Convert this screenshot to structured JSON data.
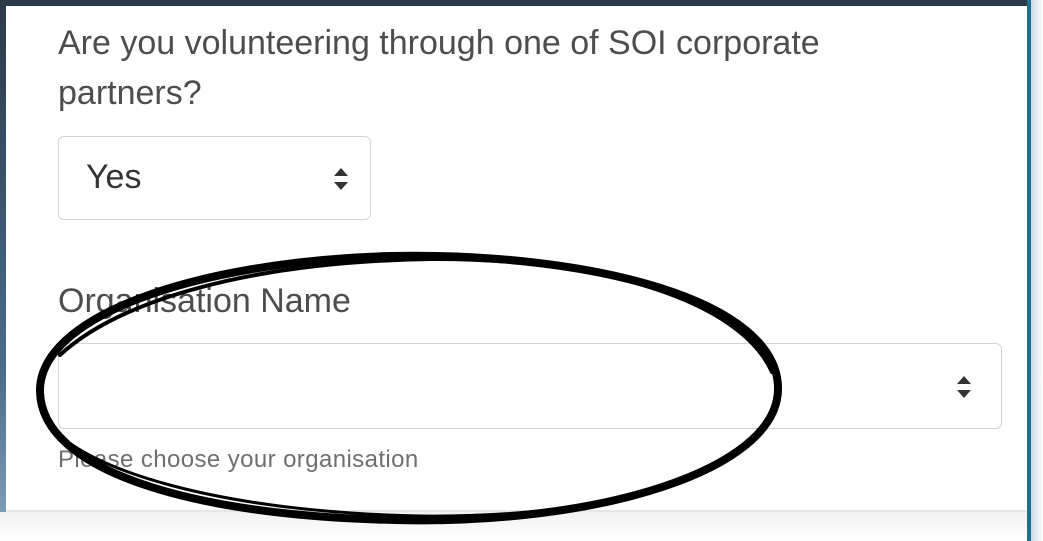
{
  "form": {
    "question_label": "Are you volunteering through one of SOI corporate partners?",
    "partner_select": {
      "selected_value": "Yes",
      "icon": "sort-arrows-icon"
    },
    "organisation": {
      "label": "Organisation Name",
      "selected_value": "",
      "icon": "sort-arrows-icon",
      "help_text": "Please choose your organisation"
    }
  },
  "annotation": {
    "shape": "hand-drawn ellipse",
    "color": "#000000"
  },
  "colors": {
    "frame_accent": "#226e8e",
    "text": "#4d4d4d",
    "help_text": "#6f6f6f",
    "field_border": "#d4d4d4"
  }
}
